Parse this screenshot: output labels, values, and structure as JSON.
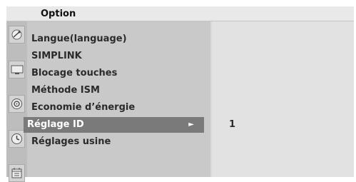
{
  "header": {
    "title": "Option"
  },
  "menu": {
    "items": [
      {
        "label": "Langue(language)"
      },
      {
        "label": "SIMPLINK"
      },
      {
        "label": "Blocage touches"
      },
      {
        "label": "Méthode ISM"
      },
      {
        "label": "Economie d’énergie"
      },
      {
        "label": "Réglage ID",
        "arrow": "►"
      },
      {
        "label": "Réglages usine"
      }
    ],
    "selected_value": "1"
  },
  "icons": [
    "satellite-dish-icon",
    "tv-screen-icon",
    "speaker-icon",
    "clock-icon",
    "calendar-icon"
  ],
  "colors": {
    "selected_bg": "#7a7a7a",
    "panel_bg": "#d9d9d9"
  }
}
